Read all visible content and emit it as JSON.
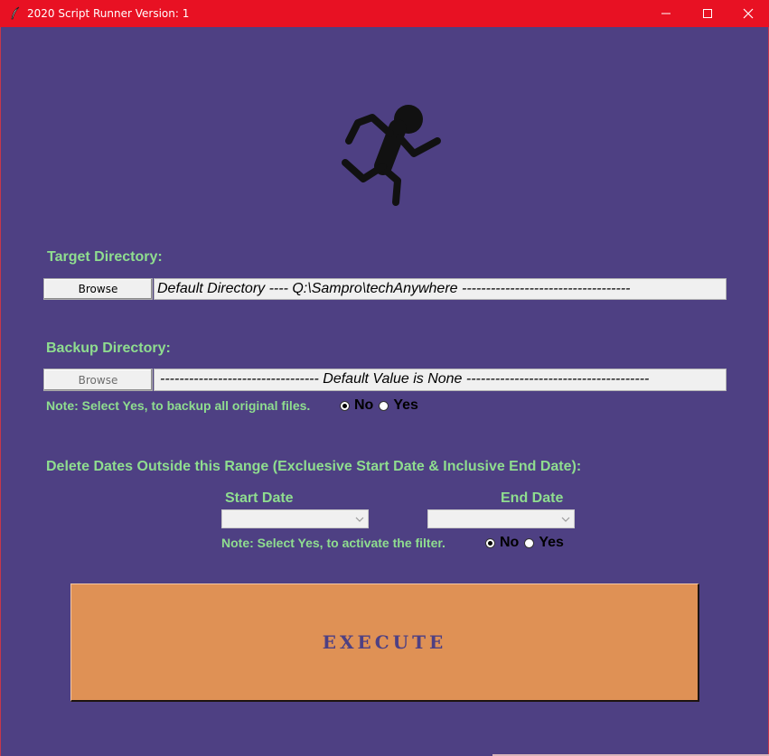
{
  "window": {
    "title": "2020 Script Runner Version: 1",
    "titlebar_color": "#e81123",
    "background_color": "#4e4083",
    "controls": [
      "minimize-icon",
      "maximize-icon",
      "close-icon"
    ]
  },
  "logo": {
    "icon": "running-person-icon"
  },
  "target": {
    "label": "Target Directory:",
    "browse_label": "Browse",
    "path_value": "Default Directory ---- Q:\\Sampro\\techAnywhere -----------------------------------"
  },
  "backup": {
    "label": "Backup Directory:",
    "browse_label": "Browse",
    "path_value": "--------------------------------- Default Value is None --------------------------------------",
    "note": "Note: Select Yes, to backup all original files.",
    "radio_no": "No",
    "radio_yes": "Yes",
    "selected": "No"
  },
  "dates": {
    "label": "Delete Dates Outside this Range (Excluesive Start Date & Inclusive End Date):",
    "start_label": "Start Date",
    "end_label": "End Date",
    "start_value": "",
    "end_value": "",
    "note": "Note: Select Yes, to activate the filter.",
    "radio_no": "No",
    "radio_yes": "Yes",
    "selected": "No"
  },
  "execute": {
    "label": "EXECUTE",
    "color": "#df9155"
  },
  "colors": {
    "label_green": "#8fdd8f"
  }
}
